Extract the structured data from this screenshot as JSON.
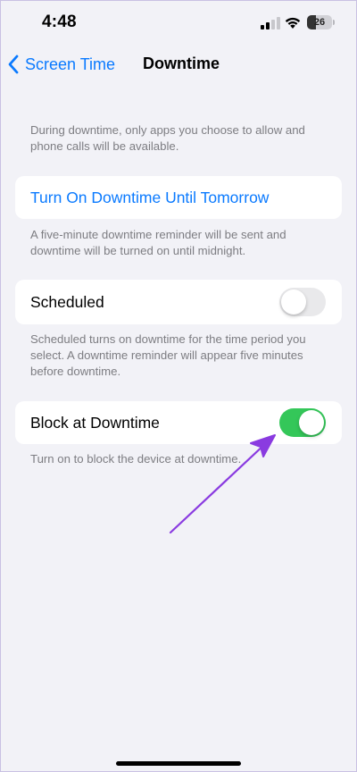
{
  "status_bar": {
    "time": "4:48",
    "battery_level": "26",
    "icons": [
      "signal-icon",
      "wifi-icon",
      "battery-icon"
    ]
  },
  "nav": {
    "back_label": "Screen Time",
    "title": "Downtime",
    "back_icon": "chevron-left-icon"
  },
  "intro_text": "During downtime, only apps you choose to allow and phone calls will be available.",
  "turn_on": {
    "label": "Turn On Downtime Until Tomorrow",
    "footnote": "A five-minute downtime reminder will be sent and downtime will be turned on until midnight."
  },
  "scheduled": {
    "label": "Scheduled",
    "enabled": false,
    "footnote": "Scheduled turns on downtime for the time period you select. A downtime reminder will appear five minutes before downtime."
  },
  "block": {
    "label": "Block at Downtime",
    "enabled": true,
    "footnote": "Turn on to block the device at downtime."
  },
  "annotation": {
    "icon": "arrow-icon",
    "color": "#8a3be0"
  },
  "colors": {
    "accent": "#0a7aff",
    "toggle_on": "#34c759",
    "toggle_off": "#e9e9eb",
    "background": "#f2f2f7"
  }
}
